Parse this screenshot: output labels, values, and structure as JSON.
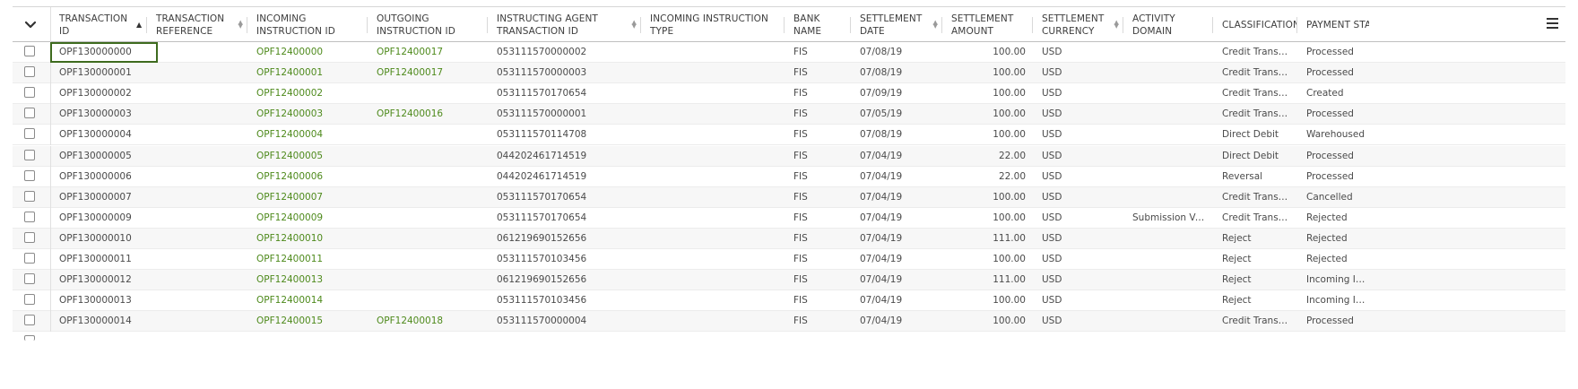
{
  "header": {
    "columns": [
      {
        "label": "TRANSACTION ID"
      },
      {
        "label": "TRANSACTION REFERENCE"
      },
      {
        "label": "INCOMING INSTRUCTION ID"
      },
      {
        "label": "OUTGOING INSTRUCTION ID"
      },
      {
        "label": "INSTRUCTING AGENT TRANSACTION ID"
      },
      {
        "label": "INCOMING INSTRUCTION TYPE"
      },
      {
        "label": "BANK NAME"
      },
      {
        "label": "SETTLEMENT DATE"
      },
      {
        "label": "SETTLEMENT AMOUNT"
      },
      {
        "label": "SETTLEMENT CURRENCY"
      },
      {
        "label": "ACTIVITY DOMAIN"
      },
      {
        "label": "CLASSIFICATION"
      },
      {
        "label": "PAYMENT STAT"
      }
    ]
  },
  "rows": [
    {
      "txn": "OPF130000000",
      "ref": "",
      "in": "OPF12400000",
      "out": "OPF12400017",
      "agent": "053111570000002",
      "type": "",
      "bank": "FIS",
      "date": "07/08/19",
      "amount": "100.00",
      "cur": "USD",
      "domain": "",
      "cls": "Credit Transfer",
      "status": "Processed"
    },
    {
      "txn": "OPF130000001",
      "ref": "",
      "in": "OPF12400001",
      "out": "OPF12400017",
      "agent": "053111570000003",
      "type": "",
      "bank": "FIS",
      "date": "07/08/19",
      "amount": "100.00",
      "cur": "USD",
      "domain": "",
      "cls": "Credit Transfer",
      "status": "Processed"
    },
    {
      "txn": "OPF130000002",
      "ref": "",
      "in": "OPF12400002",
      "out": "",
      "agent": "053111570170654",
      "type": "",
      "bank": "FIS",
      "date": "07/09/19",
      "amount": "100.00",
      "cur": "USD",
      "domain": "",
      "cls": "Credit Transfer",
      "status": "Created"
    },
    {
      "txn": "OPF130000003",
      "ref": "",
      "in": "OPF12400003",
      "out": "OPF12400016",
      "agent": "053111570000001",
      "type": "",
      "bank": "FIS",
      "date": "07/05/19",
      "amount": "100.00",
      "cur": "USD",
      "domain": "",
      "cls": "Credit Transfer",
      "status": "Processed"
    },
    {
      "txn": "OPF130000004",
      "ref": "",
      "in": "OPF12400004",
      "out": "",
      "agent": "053111570114708",
      "type": "",
      "bank": "FIS",
      "date": "07/08/19",
      "amount": "100.00",
      "cur": "USD",
      "domain": "",
      "cls": "Direct Debit",
      "status": "Warehoused"
    },
    {
      "txn": "OPF130000005",
      "ref": "",
      "in": "OPF12400005",
      "out": "",
      "agent": "044202461714519",
      "type": "",
      "bank": "FIS",
      "date": "07/04/19",
      "amount": "22.00",
      "cur": "USD",
      "domain": "",
      "cls": "Direct Debit",
      "status": "Processed"
    },
    {
      "txn": "OPF130000006",
      "ref": "",
      "in": "OPF12400006",
      "out": "",
      "agent": "044202461714519",
      "type": "",
      "bank": "FIS",
      "date": "07/04/19",
      "amount": "22.00",
      "cur": "USD",
      "domain": "",
      "cls": "Reversal",
      "status": "Processed"
    },
    {
      "txn": "OPF130000007",
      "ref": "",
      "in": "OPF12400007",
      "out": "",
      "agent": "053111570170654",
      "type": "",
      "bank": "FIS",
      "date": "07/04/19",
      "amount": "100.00",
      "cur": "USD",
      "domain": "",
      "cls": "Credit Transfer",
      "status": "Cancelled"
    },
    {
      "txn": "OPF130000009",
      "ref": "",
      "in": "OPF12400009",
      "out": "",
      "agent": "053111570170654",
      "type": "",
      "bank": "FIS",
      "date": "07/04/19",
      "amount": "100.00",
      "cur": "USD",
      "domain": "Submission Vali...",
      "cls": "Credit Transfer",
      "status": "Rejected"
    },
    {
      "txn": "OPF130000010",
      "ref": "",
      "in": "OPF12400010",
      "out": "",
      "agent": "061219690152656",
      "type": "",
      "bank": "FIS",
      "date": "07/04/19",
      "amount": "111.00",
      "cur": "USD",
      "domain": "",
      "cls": "Reject",
      "status": "Rejected"
    },
    {
      "txn": "OPF130000011",
      "ref": "",
      "in": "OPF12400011",
      "out": "",
      "agent": "053111570103456",
      "type": "",
      "bank": "FIS",
      "date": "07/04/19",
      "amount": "100.00",
      "cur": "USD",
      "domain": "",
      "cls": "Reject",
      "status": "Rejected"
    },
    {
      "txn": "OPF130000012",
      "ref": "",
      "in": "OPF12400013",
      "out": "",
      "agent": "061219690152656",
      "type": "",
      "bank": "FIS",
      "date": "07/04/19",
      "amount": "111.00",
      "cur": "USD",
      "domain": "",
      "cls": "Reject",
      "status": "Incoming Interc..."
    },
    {
      "txn": "OPF130000013",
      "ref": "",
      "in": "OPF12400014",
      "out": "",
      "agent": "053111570103456",
      "type": "",
      "bank": "FIS",
      "date": "07/04/19",
      "amount": "100.00",
      "cur": "USD",
      "domain": "",
      "cls": "Reject",
      "status": "Incoming Interc..."
    },
    {
      "txn": "OPF130000014",
      "ref": "",
      "in": "OPF12400015",
      "out": "OPF12400018",
      "agent": "053111570000004",
      "type": "",
      "bank": "FIS",
      "date": "07/04/19",
      "amount": "100.00",
      "cur": "USD",
      "domain": "",
      "cls": "Credit Transfer",
      "status": "Processed"
    }
  ]
}
